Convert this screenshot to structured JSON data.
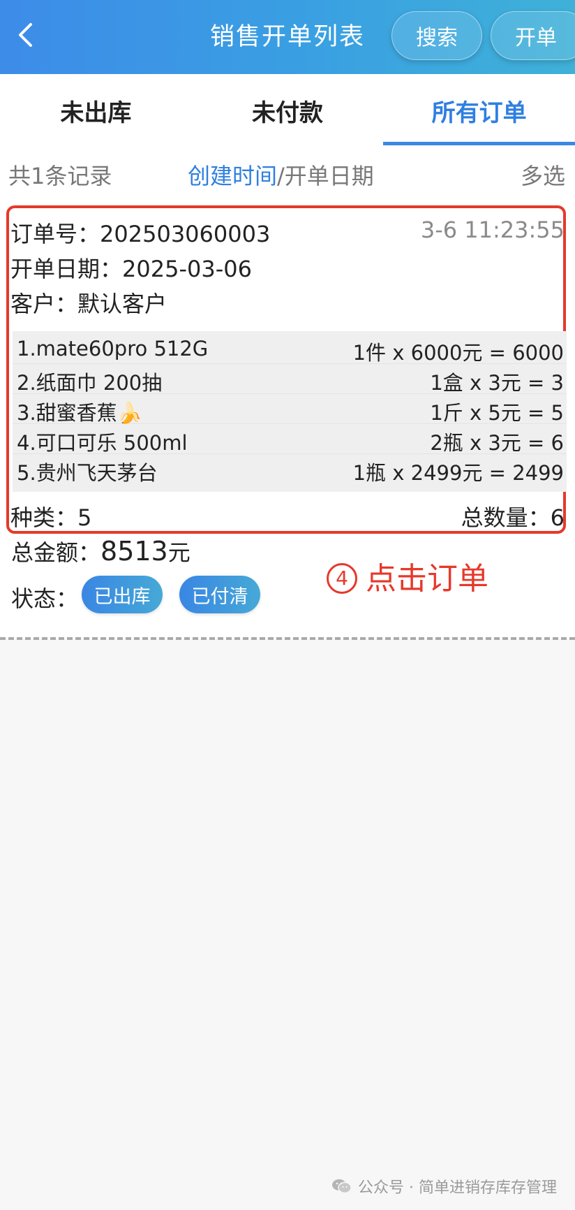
{
  "header": {
    "title": "销售开单列表",
    "search_label": "搜索",
    "new_label": "开单"
  },
  "tabs": [
    {
      "label": "未出库",
      "active": false
    },
    {
      "label": "未付款",
      "active": false
    },
    {
      "label": "所有订单",
      "active": true
    }
  ],
  "listbar": {
    "count": "共1条记录",
    "sort_active": "创建时间",
    "sort_sep": "/",
    "sort_other": "开单日期",
    "multi": "多选"
  },
  "order": {
    "order_no_label": "订单号：",
    "order_no": "202503060003",
    "time": "3-6 11:23:55",
    "date_label": "开单日期：",
    "date": "2025-03-06",
    "customer_label": "客户：",
    "customer": "默认客户",
    "items": [
      {
        "name": "1.mate60pro  512G",
        "qty": "1件 x 6000元 = 6000"
      },
      {
        "name": "2.纸面巾  200抽",
        "qty": "1盒 x 3元 = 3"
      },
      {
        "name": "3.甜蜜香蕉🍌",
        "qty": "1斤 x 5元 = 5"
      },
      {
        "name": "4.可口可乐  500ml",
        "qty": "2瓶 x 3元 = 6"
      },
      {
        "name": "5.贵州飞天茅台",
        "qty": "1瓶 x 2499元 = 2499"
      }
    ],
    "kinds_label": "种类：",
    "kinds": "5",
    "total_qty_label": "总数量：",
    "total_qty": "6",
    "amount_label": "总金额：",
    "amount_value": "8513",
    "amount_unit": "元",
    "status_label": "状态：",
    "status_badges": [
      "已出库",
      "已付清"
    ]
  },
  "annotation": {
    "num": "4",
    "text": "点击订单"
  },
  "watermark": {
    "text": "公众号 · 简单进销存库存管理",
    "icon": "wechat-icon"
  },
  "colors": {
    "accent": "#2f7fe0",
    "highlight": "#e5392b",
    "header_start": "#3d8ce8",
    "header_end": "#3fb1d8"
  }
}
